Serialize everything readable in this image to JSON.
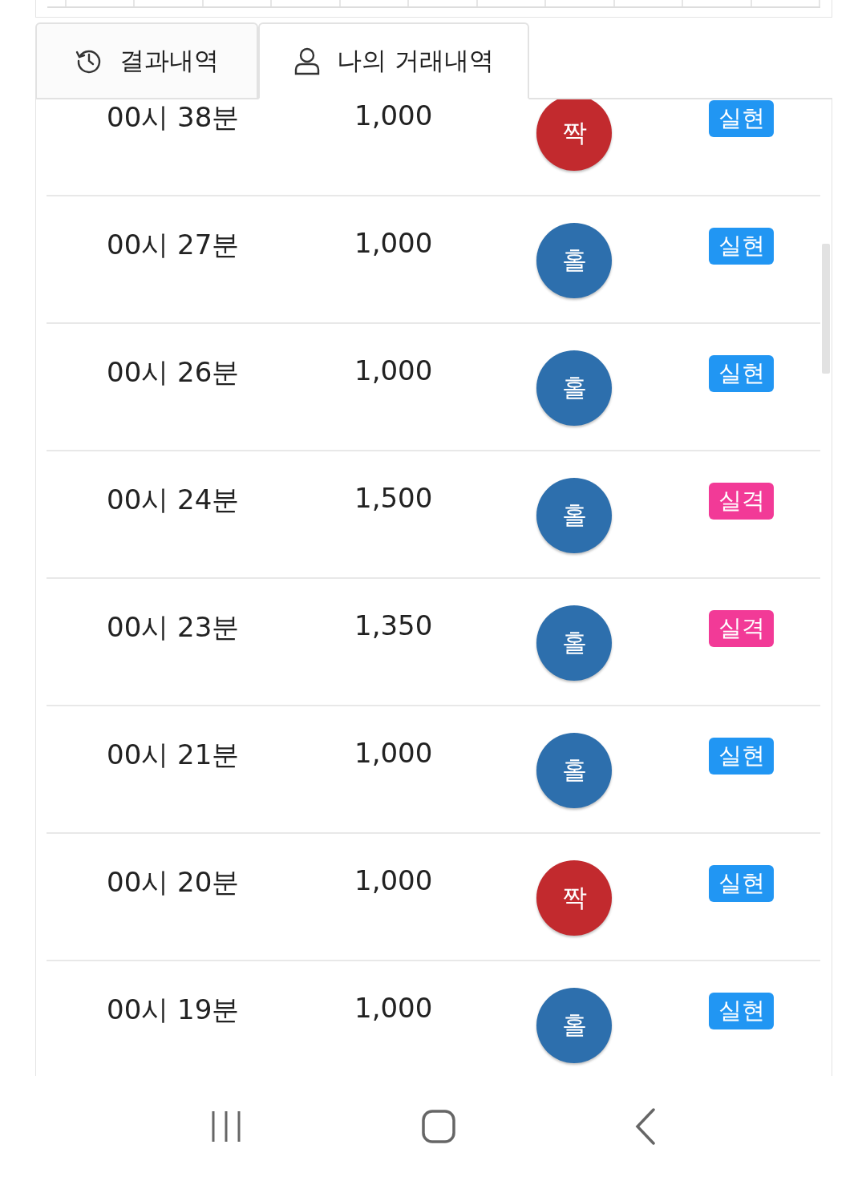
{
  "tabs": [
    {
      "label": "결과내역",
      "kind": "history",
      "selected": false
    },
    {
      "label": "나의 거래내역",
      "kind": "person",
      "selected": true
    }
  ],
  "rows": [
    {
      "time": "00시 38분",
      "amount": "1,000",
      "pick": {
        "label": "짝",
        "kind": "even"
      },
      "status": {
        "label": "실현",
        "kind": "hit"
      }
    },
    {
      "time": "00시 27분",
      "amount": "1,000",
      "pick": {
        "label": "홀",
        "kind": "odd"
      },
      "status": {
        "label": "실현",
        "kind": "hit"
      }
    },
    {
      "time": "00시 26분",
      "amount": "1,000",
      "pick": {
        "label": "홀",
        "kind": "odd"
      },
      "status": {
        "label": "실현",
        "kind": "hit"
      }
    },
    {
      "time": "00시 24분",
      "amount": "1,500",
      "pick": {
        "label": "홀",
        "kind": "odd"
      },
      "status": {
        "label": "실격",
        "kind": "miss"
      }
    },
    {
      "time": "00시 23분",
      "amount": "1,350",
      "pick": {
        "label": "홀",
        "kind": "odd"
      },
      "status": {
        "label": "실격",
        "kind": "miss"
      }
    },
    {
      "time": "00시 21분",
      "amount": "1,000",
      "pick": {
        "label": "홀",
        "kind": "odd"
      },
      "status": {
        "label": "실현",
        "kind": "hit"
      }
    },
    {
      "time": "00시 20분",
      "amount": "1,000",
      "pick": {
        "label": "짝",
        "kind": "even"
      },
      "status": {
        "label": "실현",
        "kind": "hit"
      }
    },
    {
      "time": "00시 19분",
      "amount": "1,000",
      "pick": {
        "label": "홀",
        "kind": "odd"
      },
      "status": {
        "label": "실현",
        "kind": "hit"
      }
    }
  ]
}
